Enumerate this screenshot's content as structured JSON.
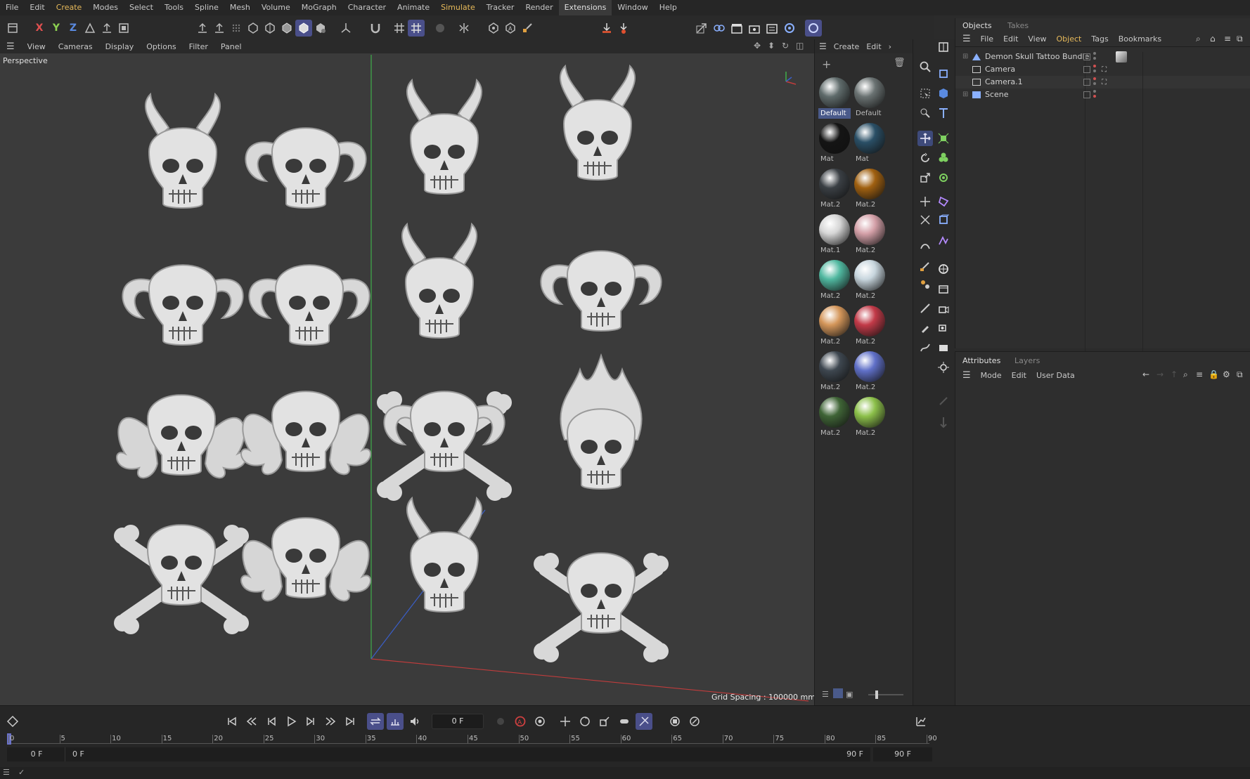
{
  "menu": [
    "File",
    "Edit",
    "Create",
    "Modes",
    "Select",
    "Tools",
    "Spline",
    "Mesh",
    "Volume",
    "MoGraph",
    "Character",
    "Animate",
    "Simulate",
    "Tracker",
    "Render",
    "Extensions",
    "Window",
    "Help"
  ],
  "viewport_menu": [
    "View",
    "Cameras",
    "Display",
    "Options",
    "Filter",
    "Panel"
  ],
  "viewport": {
    "label": "Perspective",
    "grid_spacing": "Grid Spacing : 100000 mm"
  },
  "axes": {
    "x": "X",
    "y": "Y",
    "z": "Z"
  },
  "material_manager": {
    "menu": [
      "Create",
      "Edit"
    ],
    "materials": [
      {
        "name": "Default",
        "color": "#5f6b6b",
        "selected": true
      },
      {
        "name": "Default",
        "color": "#6a7272",
        "selected": false
      },
      {
        "name": "Mat",
        "color": "#141414",
        "selected": false
      },
      {
        "name": "Mat",
        "color": "#2a4f66",
        "selected": false
      },
      {
        "name": "Mat.2",
        "color": "#3a3f44",
        "selected": false
      },
      {
        "name": "Mat.2",
        "color": "#a06010",
        "selected": false
      },
      {
        "name": "Mat.1",
        "color": "#d6d6d6",
        "selected": false
      },
      {
        "name": "Mat.2",
        "color": "#d4a0a8",
        "selected": false
      },
      {
        "name": "Mat.2",
        "color": "#50b8a0",
        "selected": false
      },
      {
        "name": "Mat.2",
        "color": "#c8d6de",
        "selected": false
      },
      {
        "name": "Mat.2",
        "color": "#d4965a",
        "selected": false
      },
      {
        "name": "Mat.2",
        "color": "#c23a48",
        "selected": false
      },
      {
        "name": "Mat.2",
        "color": "#3e4750",
        "selected": false
      },
      {
        "name": "Mat.2",
        "color": "#6070c8",
        "selected": false
      },
      {
        "name": "Mat.2",
        "color": "#3f6436",
        "selected": false
      },
      {
        "name": "Mat.2",
        "color": "#8cc04a",
        "selected": false
      }
    ]
  },
  "objects_panel": {
    "tabs": [
      "Objects",
      "Takes"
    ],
    "menu": [
      "File",
      "Edit",
      "View",
      "Object",
      "Tags",
      "Bookmarks"
    ],
    "items": [
      "Demon Skull Tattoo Bundle",
      "Camera",
      "Camera.1",
      "Scene"
    ]
  },
  "attributes_panel": {
    "tabs": [
      "Attributes",
      "Layers"
    ],
    "menu": [
      "Mode",
      "Edit",
      "User Data"
    ]
  },
  "timeline": {
    "current_frame": "0 F",
    "ticks": [
      "0",
      "5",
      "10",
      "15",
      "20",
      "25",
      "30",
      "35",
      "40",
      "45",
      "50",
      "55",
      "60",
      "65",
      "70",
      "75",
      "80",
      "85",
      "90"
    ],
    "start": "0 F",
    "preview_start": "0 F",
    "preview_end": "90 F",
    "end": "90 F"
  },
  "colors": {
    "accent": "#4a4f8a",
    "highlight_text": "#e6b95a",
    "viewport_bg": "#3b3b3b",
    "skull": "#e4e4e4"
  }
}
